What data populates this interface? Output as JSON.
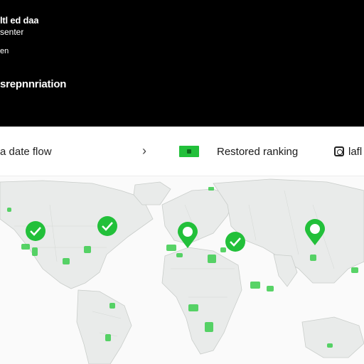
{
  "header": {
    "lines": [
      "ltl ed daa",
      "senter",
      "en",
      "srepnnriation"
    ]
  },
  "toolbar": {
    "left_label": "a date flow",
    "chevron": "›",
    "title": "Restored ranking",
    "right_label": "lafl",
    "accent_color": "#22c03a"
  },
  "map": {
    "markers": [
      {
        "id": "marker-north-america-west",
        "type": "check"
      },
      {
        "id": "marker-north-america-east",
        "type": "check"
      },
      {
        "id": "marker-europe",
        "type": "pin"
      },
      {
        "id": "marker-middle-east",
        "type": "check"
      },
      {
        "id": "marker-east-asia",
        "type": "pin"
      }
    ]
  }
}
